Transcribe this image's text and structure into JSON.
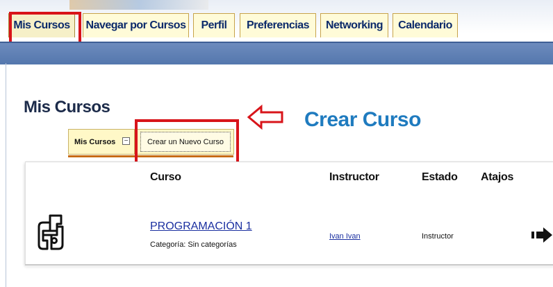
{
  "tabs": [
    {
      "label": "Mis Cursos",
      "active": true
    },
    {
      "label": "Navegar por Cursos",
      "active": false
    },
    {
      "label": "Perfil",
      "active": false
    },
    {
      "label": "Preferencias",
      "active": false
    },
    {
      "label": "Networking",
      "active": false
    },
    {
      "label": "Calendario",
      "active": false
    }
  ],
  "page": {
    "title": "Mis Cursos",
    "annotation_label": "Crear Curso"
  },
  "subtabs": {
    "mis_cursos": "Mis Cursos",
    "collapse_symbol": "−",
    "new_course": "Crear un Nuevo Curso"
  },
  "table": {
    "headers": {
      "curso": "Curso",
      "instructor": "Instructor",
      "estado": "Estado",
      "atajos": "Atajos"
    },
    "rows": [
      {
        "name": "PROGRAMACIÓN 1",
        "category": "Categoría: Sin categorías",
        "instructor": "Ivan Ivan",
        "estado": "Instructor"
      }
    ]
  },
  "colors": {
    "highlight": "#d8141a",
    "nav_bar": "#5b7db3",
    "tab_bg": "#fffbd8",
    "title_blue": "#1f7bbf",
    "link": "#1a2fa0"
  },
  "icons": {
    "annotation_arrow": "arrow-left-outline-icon",
    "course_logo": "course-logo-icon",
    "enter_course": "arrow-right-icon"
  }
}
